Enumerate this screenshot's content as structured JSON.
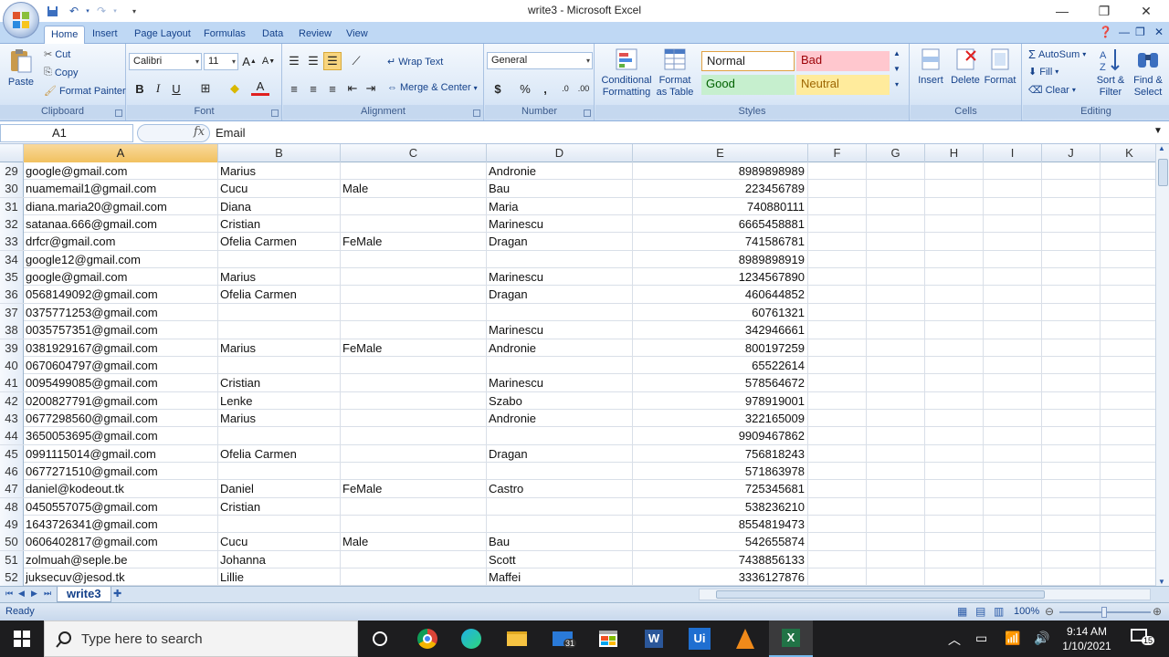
{
  "window": {
    "title": "write3 - Microsoft Excel"
  },
  "qat": {
    "save": "save-icon",
    "undo": "undo-icon",
    "redo": "redo-icon"
  },
  "tabs": [
    "Home",
    "Insert",
    "Page Layout",
    "Formulas",
    "Data",
    "Review",
    "View"
  ],
  "ribbon": {
    "clipboard": {
      "label": "Clipboard",
      "paste": "Paste",
      "cut": "Cut",
      "copy": "Copy",
      "format_painter": "Format Painter"
    },
    "font": {
      "label": "Font",
      "family": "Calibri",
      "size": "11",
      "bold": "B",
      "italic": "I",
      "underline": "U",
      "font_color": "A"
    },
    "alignment": {
      "label": "Alignment",
      "wrap_text": "Wrap Text",
      "merge_center": "Merge & Center"
    },
    "number": {
      "label": "Number",
      "format": "General",
      "currency": "$",
      "percent": "%",
      "comma": ","
    },
    "styles": {
      "label": "Styles",
      "conditional": "Conditional",
      "conditional2": "Formatting",
      "format_as": "Format",
      "format_as2": "as Table",
      "normal": "Normal",
      "bad": "Bad",
      "good": "Good",
      "neutral": "Neutral"
    },
    "cells": {
      "label": "Cells",
      "insert": "Insert",
      "delete": "Delete",
      "format": "Format"
    },
    "editing": {
      "label": "Editing",
      "autosum": "AutoSum",
      "fill": "Fill",
      "clear": "Clear",
      "sort": "Sort &",
      "sort2": "Filter",
      "find": "Find &",
      "find2": "Select"
    }
  },
  "formula_bar": {
    "name_box": "A1",
    "fx": "fx",
    "content": "Email"
  },
  "columns": [
    "A",
    "B",
    "C",
    "D",
    "E",
    "F",
    "G",
    "H",
    "I",
    "J",
    "K"
  ],
  "rows": [
    {
      "n": "29",
      "a": "google@gmail.com",
      "b": "Marius",
      "c": "",
      "d": "Andronie",
      "e": "8989898989"
    },
    {
      "n": "30",
      "a": "nuamemail1@gmail.com",
      "b": "Cucu",
      "c": "Male",
      "d": "Bau",
      "e": "223456789"
    },
    {
      "n": "31",
      "a": "diana.maria20@gmail.com",
      "b": "Diana",
      "c": "",
      "d": "Maria",
      "e": "740880111"
    },
    {
      "n": "32",
      "a": "satanaa.666@gmail.com",
      "b": "Cristian",
      "c": "",
      "d": "Marinescu",
      "e": "6665458881"
    },
    {
      "n": "33",
      "a": "drfcr@gmail.com",
      "b": "Ofelia Carmen",
      "c": "FeMale",
      "d": "Dragan",
      "e": "741586781"
    },
    {
      "n": "34",
      "a": "google12@gmail.com",
      "b": "",
      "c": "",
      "d": "",
      "e": "8989898919"
    },
    {
      "n": "35",
      "a": "google@gmail.com",
      "b": "Marius",
      "c": "",
      "d": "Marinescu",
      "e": "1234567890"
    },
    {
      "n": "36",
      "a": "0568149092@gmail.com",
      "b": "Ofelia Carmen",
      "c": "",
      "d": "Dragan",
      "e": "460644852"
    },
    {
      "n": "37",
      "a": "0375771253@gmail.com",
      "b": "",
      "c": "",
      "d": "",
      "e": "60761321"
    },
    {
      "n": "38",
      "a": "0035757351@gmail.com",
      "b": "",
      "c": "",
      "d": "Marinescu",
      "e": "342946661"
    },
    {
      "n": "39",
      "a": "0381929167@gmail.com",
      "b": "Marius",
      "c": "FeMale",
      "d": "Andronie",
      "e": "800197259"
    },
    {
      "n": "40",
      "a": "0670604797@gmail.com",
      "b": "",
      "c": "",
      "d": "",
      "e": "65522614"
    },
    {
      "n": "41",
      "a": "0095499085@gmail.com",
      "b": "Cristian",
      "c": "",
      "d": "Marinescu",
      "e": "578564672"
    },
    {
      "n": "42",
      "a": "0200827791@gmail.com",
      "b": "Lenke",
      "c": "",
      "d": "Szabo",
      "e": "978919001"
    },
    {
      "n": "43",
      "a": "0677298560@gmail.com",
      "b": "Marius",
      "c": "",
      "d": "Andronie",
      "e": "322165009"
    },
    {
      "n": "44",
      "a": "3650053695@gmail.com",
      "b": "",
      "c": "",
      "d": "",
      "e": "9909467862"
    },
    {
      "n": "45",
      "a": "0991115014@gmail.com",
      "b": "Ofelia Carmen",
      "c": "",
      "d": "Dragan",
      "e": "756818243"
    },
    {
      "n": "46",
      "a": "0677271510@gmail.com",
      "b": "",
      "c": "",
      "d": "",
      "e": "571863978"
    },
    {
      "n": "47",
      "a": "daniel@kodeout.tk",
      "b": "Daniel",
      "c": "FeMale",
      "d": "Castro",
      "e": "725345681"
    },
    {
      "n": "48",
      "a": "0450557075@gmail.com",
      "b": "Cristian",
      "c": "",
      "d": "",
      "e": "538236210"
    },
    {
      "n": "49",
      "a": "1643726341@gmail.com",
      "b": "",
      "c": "",
      "d": "",
      "e": "8554819473"
    },
    {
      "n": "50",
      "a": "0606402817@gmail.com",
      "b": "Cucu",
      "c": "Male",
      "d": "Bau",
      "e": "542655874"
    },
    {
      "n": "51",
      "a": "zolmuah@seple.be",
      "b": "Johanna",
      "c": "",
      "d": "Scott",
      "e": "7438856133"
    },
    {
      "n": "52",
      "a": "juksecuv@jesod.tk",
      "b": "Lillie",
      "c": "",
      "d": "Maffei",
      "e": "3336127876"
    }
  ],
  "sheet_tab": "write3",
  "status": {
    "text": "Ready",
    "zoom": "100%"
  },
  "taskbar": {
    "search_placeholder": "Type here to search",
    "time": "9:14 AM",
    "date": "1/10/2021",
    "mail_badge": "31",
    "notif_badge": "15"
  },
  "colors": {
    "accent": "#15428b",
    "ribbon": "#dbe8f7",
    "selected_header": "#f1c15f"
  }
}
